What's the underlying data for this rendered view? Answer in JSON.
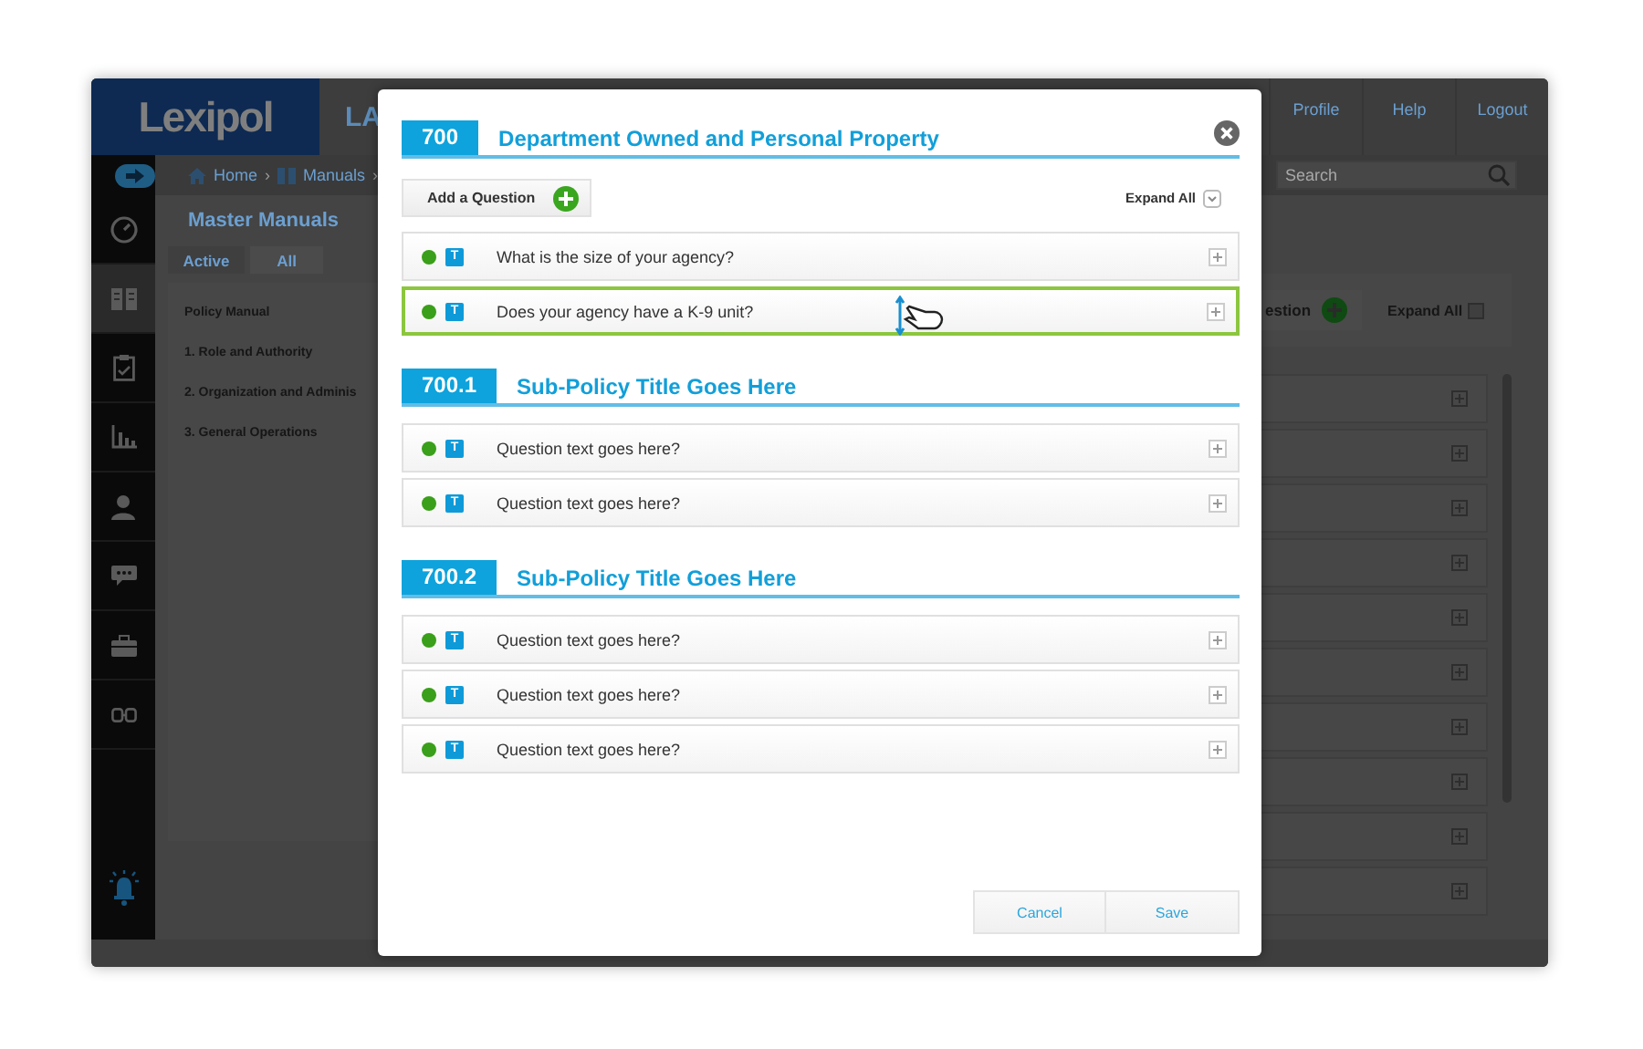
{
  "app": {
    "logo": "Lexipol",
    "header_title": "LA",
    "nav": [
      "Profile",
      "Help",
      "Logout"
    ],
    "breadcrumb_separator": "›",
    "breadcrumb": [
      {
        "label": "Home",
        "kind": "home"
      },
      {
        "label": "Manuals",
        "kind": "manuals"
      }
    ],
    "search": {
      "placeholder": "Search"
    },
    "sidebar": {
      "items": [
        {
          "kind": "gauge",
          "selected": false
        },
        {
          "kind": "book",
          "selected": true
        },
        {
          "kind": "clipboard",
          "selected": false
        },
        {
          "kind": "chart",
          "selected": false
        },
        {
          "kind": "person",
          "selected": false
        },
        {
          "kind": "chat",
          "selected": false
        },
        {
          "kind": "briefcase",
          "selected": false
        },
        {
          "kind": "link",
          "selected": false
        }
      ]
    },
    "page_title": "Master Manuals",
    "tabs": [
      {
        "label": "Active",
        "selected": false
      },
      {
        "label": "All",
        "selected": true
      }
    ],
    "manual_list": {
      "header": "Policy Manual",
      "items": [
        "1.  Role and Authority",
        "2.  Organization and Adminis",
        "3.  General Operations"
      ]
    },
    "toolbar": {
      "add_button": "estion",
      "expand_all": "Expand All"
    }
  },
  "modal": {
    "add_question": "Add a Question",
    "expand_all": "Expand All",
    "sections": [
      {
        "number": "700",
        "title": "Department Owned and Personal Property",
        "questions": [
          {
            "badge": "T",
            "text": "What is the size of your agency?",
            "selected": false
          },
          {
            "badge": "T",
            "text": "Does your agency have a K-9 unit?",
            "selected": true
          }
        ]
      },
      {
        "number": "700.1",
        "title": "Sub-Policy Title Goes Here",
        "questions": [
          {
            "badge": "T",
            "text": "Question text goes here?",
            "selected": false
          },
          {
            "badge": "T",
            "text": "Question text goes here?",
            "selected": false
          }
        ]
      },
      {
        "number": "700.2",
        "title": "Sub-Policy Title Goes Here",
        "questions": [
          {
            "badge": "T",
            "text": "Question text goes here?",
            "selected": false
          },
          {
            "badge": "T",
            "text": "Question text goes here?",
            "selected": false
          },
          {
            "badge": "T",
            "text": "Question text goes here?",
            "selected": false
          }
        ]
      }
    ],
    "buttons": [
      "Cancel",
      "Save"
    ]
  }
}
